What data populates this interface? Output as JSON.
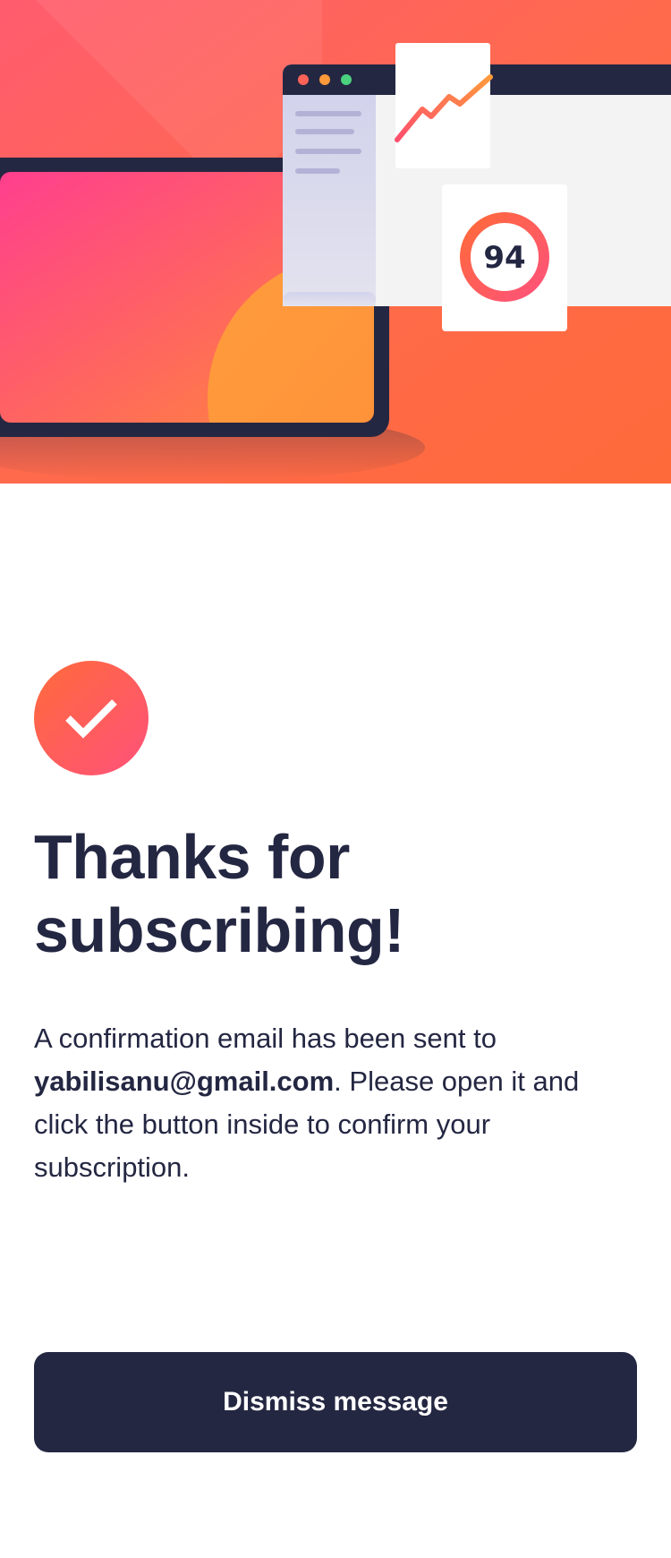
{
  "hero": {
    "score_value": "94",
    "window_dots": [
      "#ff6257",
      "#ff9a3a",
      "#4ad27f"
    ]
  },
  "success": {
    "icon": "check-icon",
    "title": "Thanks for subscribing!",
    "message_prefix": "A confirmation email has been sent to ",
    "email": "yabilisanu@gmail.com",
    "message_suffix": ". Please open it and click the button inside to confirm your subscription."
  },
  "actions": {
    "dismiss_label": "Dismiss message"
  },
  "colors": {
    "navy": "#242742",
    "accent_start": "#ff6a3a",
    "accent_end": "#ff527b",
    "background": "#ffffff"
  }
}
